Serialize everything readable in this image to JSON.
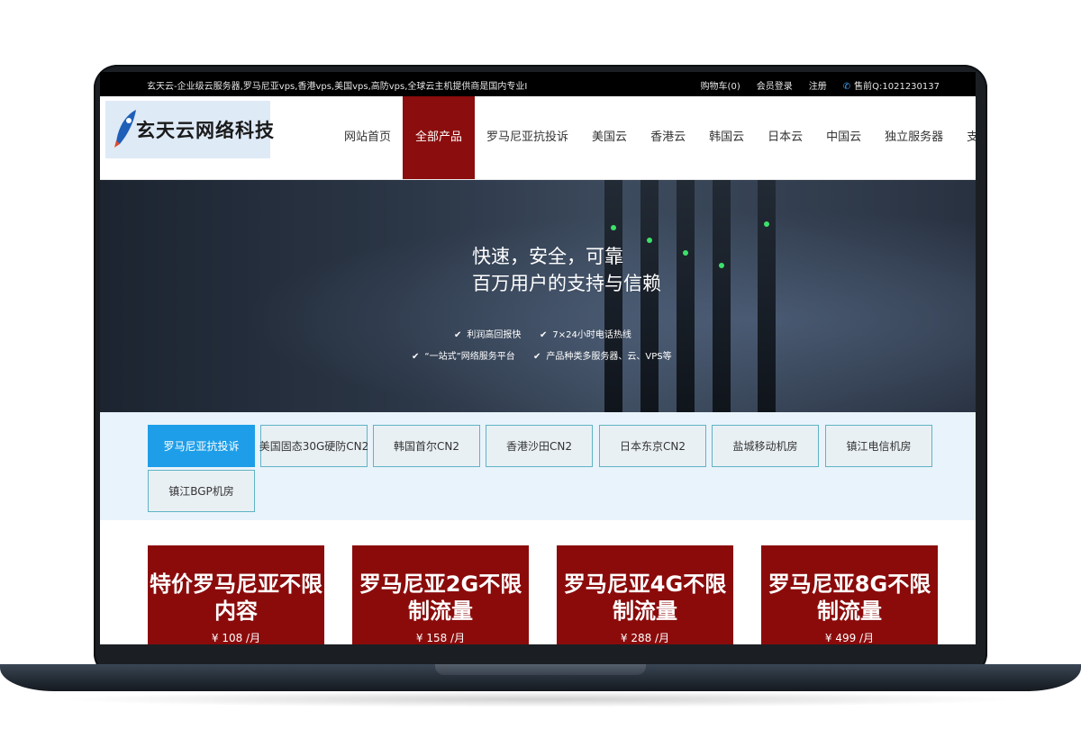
{
  "topbar": {
    "tagline": "玄天云-企业级云服务器,罗马尼亚vps,香港vps,美国vps,高防vps,全球云主机提供商是国内专业I",
    "cart": "购物车(0)",
    "login": "会员登录",
    "register": "注册",
    "presales_qq": "售前Q:1021230137"
  },
  "logo": {
    "text": "玄天云网络科技"
  },
  "nav": {
    "items": [
      {
        "label": "网站首页",
        "active": false
      },
      {
        "label": "全部产品",
        "active": true
      },
      {
        "label": "罗马尼亚抗投诉",
        "active": false
      },
      {
        "label": "美国云",
        "active": false
      },
      {
        "label": "香港云",
        "active": false
      },
      {
        "label": "韩国云",
        "active": false
      },
      {
        "label": "日本云",
        "active": false
      },
      {
        "label": "中国云",
        "active": false
      },
      {
        "label": "独立服务器",
        "active": false
      },
      {
        "label": "支付方式",
        "active": false
      }
    ]
  },
  "hero": {
    "line1": "快速，安全，可靠",
    "line2": "百万用户的支持与信赖",
    "features": [
      "利润高回报快",
      "7×24小时电话热线",
      "“一站式”网络服务平台",
      "产品种类多服务器、云、VPS等"
    ]
  },
  "tabs": [
    {
      "label": "罗马尼亚抗投诉",
      "active": true
    },
    {
      "label": "美国固态30G硬防CN2",
      "active": false
    },
    {
      "label": "韩国首尔CN2",
      "active": false
    },
    {
      "label": "香港沙田CN2",
      "active": false
    },
    {
      "label": "日本东京CN2",
      "active": false
    },
    {
      "label": "盐城移动机房",
      "active": false
    },
    {
      "label": "镇江电信机房",
      "active": false
    },
    {
      "label": "镇江BGP机房",
      "active": false
    }
  ],
  "products": [
    {
      "title": "特价罗马尼亚不限内容",
      "price": "¥ 108 /月"
    },
    {
      "title": "罗马尼亚2G不限制流量",
      "price": "¥ 158 /月"
    },
    {
      "title": "罗马尼亚4G不限制流量",
      "price": "¥ 288 /月"
    },
    {
      "title": "罗马尼亚8G不限制流量",
      "price": "¥ 499 /月"
    }
  ],
  "colors": {
    "accent_red": "#8b0d0d",
    "tab_active": "#1e9ee8",
    "topbar_bg": "#000000"
  }
}
